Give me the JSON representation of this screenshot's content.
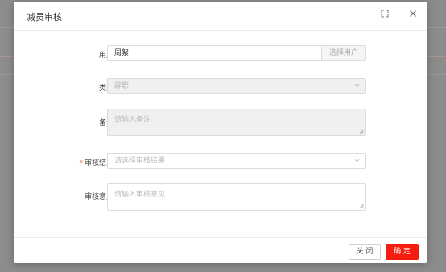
{
  "dialog": {
    "title": "减员审核",
    "maximize_icon": "expand-icon",
    "close_icon": "close-icon"
  },
  "form": {
    "user": {
      "label": "用户:",
      "value": "周絮",
      "addon_label": "选择用户"
    },
    "type": {
      "label": "类型:",
      "value": "辞职",
      "disabled": true
    },
    "remark": {
      "label": "备注:",
      "placeholder": "请输入备注",
      "disabled": true
    },
    "result": {
      "label": "审核结果:",
      "required_mark": "*",
      "placeholder": "请选择审核结果"
    },
    "opinion": {
      "label": "审核意见:",
      "placeholder": "请输入审核意见"
    }
  },
  "footer": {
    "close_label": "关 闭",
    "confirm_label": "确 定"
  },
  "colors": {
    "primary": "#f51d0f",
    "required": "#ee3322",
    "disabled_bg": "#f0f0f0"
  }
}
